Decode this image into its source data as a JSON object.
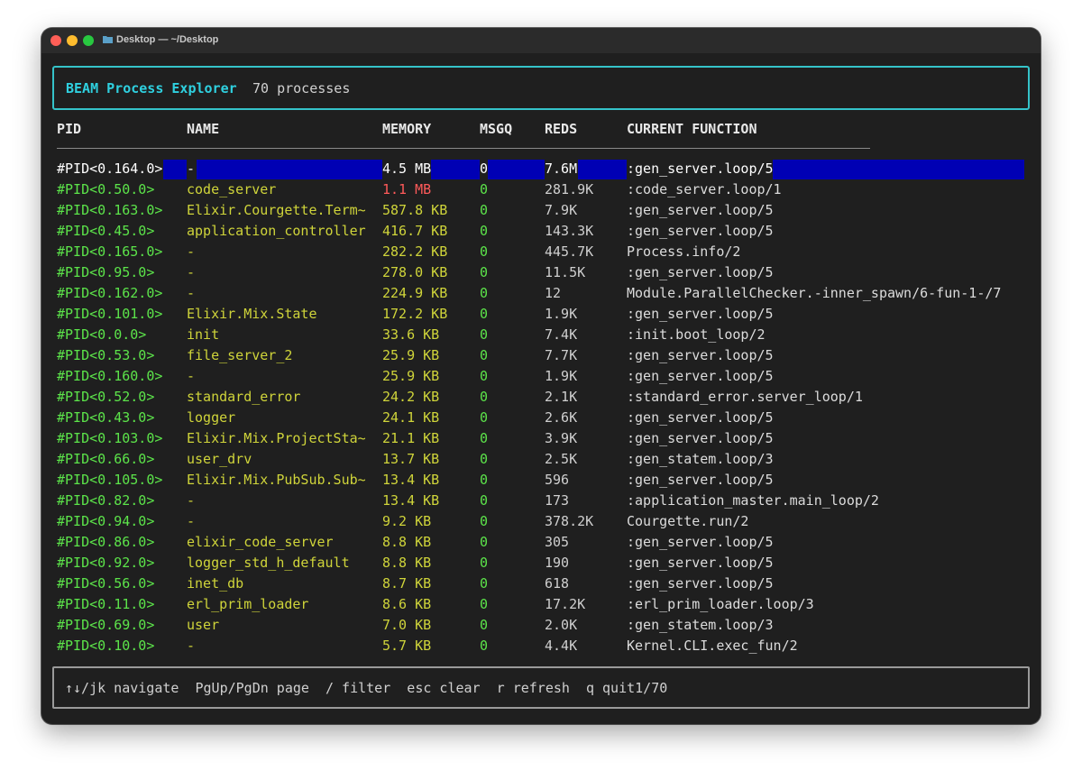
{
  "window": {
    "title": "Desktop — ~/Desktop"
  },
  "header": {
    "app_title": "BEAM Process Explorer",
    "count": "70 processes"
  },
  "columns": {
    "pid": "PID",
    "name": "NAME",
    "memory": "MEMORY",
    "msgq": "MSGQ",
    "reds": "REDS",
    "fn": "CURRENT FUNCTION"
  },
  "colors": {
    "accent": "#35c3c9",
    "pid": "#5ce44a",
    "name": "#cfd43a",
    "mem_high": "#ff5a5a",
    "selection": "#0000b4"
  },
  "rows": [
    {
      "pid": "#PID<0.164.0>",
      "name": "-",
      "memory": "4.5 MB",
      "msgq": "0",
      "reds": "7.6M",
      "fn": ":gen_server.loop/5"
    },
    {
      "pid": "#PID<0.50.0>",
      "name": "code_server",
      "memory": "1.1 MB",
      "msgq": "0",
      "reds": "281.9K",
      "fn": ":code_server.loop/1"
    },
    {
      "pid": "#PID<0.163.0>",
      "name": "Elixir.Courgette.Term~",
      "memory": "587.8 KB",
      "msgq": "0",
      "reds": "7.9K",
      "fn": ":gen_server.loop/5"
    },
    {
      "pid": "#PID<0.45.0>",
      "name": "application_controller",
      "memory": "416.7 KB",
      "msgq": "0",
      "reds": "143.3K",
      "fn": ":gen_server.loop/5"
    },
    {
      "pid": "#PID<0.165.0>",
      "name": "-",
      "memory": "282.2 KB",
      "msgq": "0",
      "reds": "445.7K",
      "fn": "Process.info/2"
    },
    {
      "pid": "#PID<0.95.0>",
      "name": "-",
      "memory": "278.0 KB",
      "msgq": "0",
      "reds": "11.5K",
      "fn": ":gen_server.loop/5"
    },
    {
      "pid": "#PID<0.162.0>",
      "name": "-",
      "memory": "224.9 KB",
      "msgq": "0",
      "reds": "12",
      "fn": "Module.ParallelChecker.-inner_spawn/6-fun-1-/7"
    },
    {
      "pid": "#PID<0.101.0>",
      "name": "Elixir.Mix.State",
      "memory": "172.2 KB",
      "msgq": "0",
      "reds": "1.9K",
      "fn": ":gen_server.loop/5"
    },
    {
      "pid": "#PID<0.0.0>",
      "name": "init",
      "memory": "33.6 KB",
      "msgq": "0",
      "reds": "7.4K",
      "fn": ":init.boot_loop/2"
    },
    {
      "pid": "#PID<0.53.0>",
      "name": "file_server_2",
      "memory": "25.9 KB",
      "msgq": "0",
      "reds": "7.7K",
      "fn": ":gen_server.loop/5"
    },
    {
      "pid": "#PID<0.160.0>",
      "name": "-",
      "memory": "25.9 KB",
      "msgq": "0",
      "reds": "1.9K",
      "fn": ":gen_server.loop/5"
    },
    {
      "pid": "#PID<0.52.0>",
      "name": "standard_error",
      "memory": "24.2 KB",
      "msgq": "0",
      "reds": "2.1K",
      "fn": ":standard_error.server_loop/1"
    },
    {
      "pid": "#PID<0.43.0>",
      "name": "logger",
      "memory": "24.1 KB",
      "msgq": "0",
      "reds": "2.6K",
      "fn": ":gen_server.loop/5"
    },
    {
      "pid": "#PID<0.103.0>",
      "name": "Elixir.Mix.ProjectSta~",
      "memory": "21.1 KB",
      "msgq": "0",
      "reds": "3.9K",
      "fn": ":gen_server.loop/5"
    },
    {
      "pid": "#PID<0.66.0>",
      "name": "user_drv",
      "memory": "13.7 KB",
      "msgq": "0",
      "reds": "2.5K",
      "fn": ":gen_statem.loop/3"
    },
    {
      "pid": "#PID<0.105.0>",
      "name": "Elixir.Mix.PubSub.Sub~",
      "memory": "13.4 KB",
      "msgq": "0",
      "reds": "596",
      "fn": ":gen_server.loop/5"
    },
    {
      "pid": "#PID<0.82.0>",
      "name": "-",
      "memory": "13.4 KB",
      "msgq": "0",
      "reds": "173",
      "fn": ":application_master.main_loop/2"
    },
    {
      "pid": "#PID<0.94.0>",
      "name": "-",
      "memory": "9.2 KB",
      "msgq": "0",
      "reds": "378.2K",
      "fn": "Courgette.run/2"
    },
    {
      "pid": "#PID<0.86.0>",
      "name": "elixir_code_server",
      "memory": "8.8 KB",
      "msgq": "0",
      "reds": "305",
      "fn": ":gen_server.loop/5"
    },
    {
      "pid": "#PID<0.92.0>",
      "name": "logger_std_h_default",
      "memory": "8.8 KB",
      "msgq": "0",
      "reds": "190",
      "fn": ":gen_server.loop/5"
    },
    {
      "pid": "#PID<0.56.0>",
      "name": "inet_db",
      "memory": "8.7 KB",
      "msgq": "0",
      "reds": "618",
      "fn": ":gen_server.loop/5"
    },
    {
      "pid": "#PID<0.11.0>",
      "name": "erl_prim_loader",
      "memory": "8.6 KB",
      "msgq": "0",
      "reds": "17.2K",
      "fn": ":erl_prim_loader.loop/3"
    },
    {
      "pid": "#PID<0.69.0>",
      "name": "user",
      "memory": "7.0 KB",
      "msgq": "0",
      "reds": "2.0K",
      "fn": ":gen_statem.loop/3"
    },
    {
      "pid": "#PID<0.10.0>",
      "name": "-",
      "memory": "5.7 KB",
      "msgq": "0",
      "reds": "4.4K",
      "fn": "Kernel.CLI.exec_fun/2"
    }
  ],
  "footer": {
    "help": "↑↓/jk navigate  PgUp/PgDn page  / filter  esc clear  r refresh  q quit1/70"
  }
}
